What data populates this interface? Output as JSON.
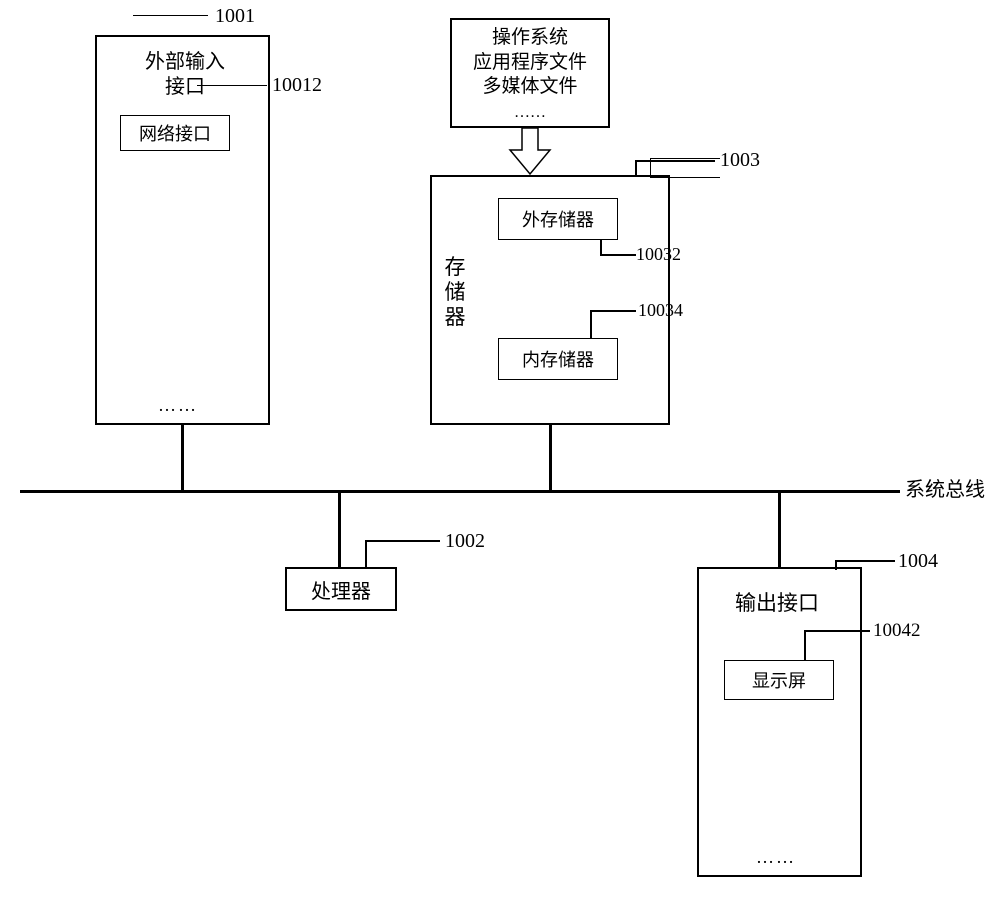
{
  "bus": {
    "label": "系统总线"
  },
  "input_interface": {
    "ref": "1001",
    "title_l1": "外部输入",
    "title_l2": "接口",
    "network_if": {
      "label": "网络接口",
      "ref": "10012"
    }
  },
  "source_files": {
    "l1": "操作系统",
    "l2": "应用程序文件",
    "l3": "多媒体文件",
    "dots": "……"
  },
  "memory": {
    "ref": "1003",
    "title_v": "存储器",
    "external": {
      "label": "外存储器",
      "ref": "10032"
    },
    "internal": {
      "label": "内存储器",
      "ref": "10034"
    }
  },
  "processor": {
    "label": "处理器",
    "ref": "1002"
  },
  "output_interface": {
    "ref": "1004",
    "title": "输出接口",
    "display": {
      "label": "显示屏",
      "ref": "10042"
    }
  },
  "dots": "……"
}
